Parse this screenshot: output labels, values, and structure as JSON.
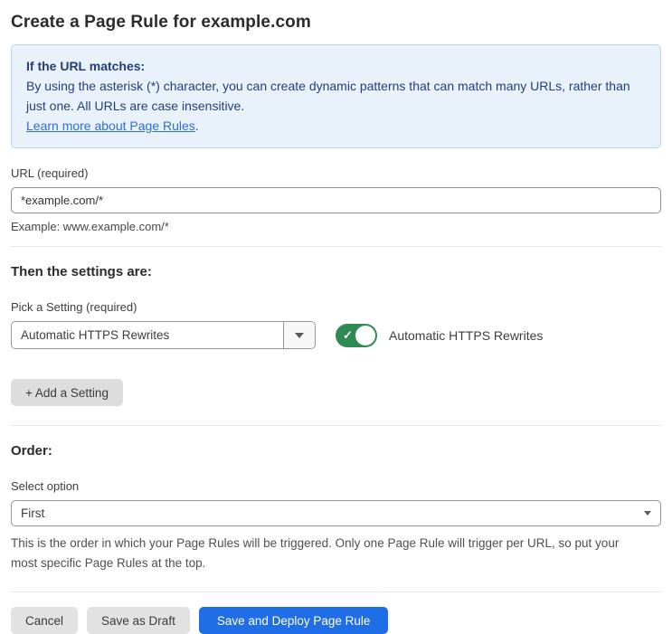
{
  "page": {
    "title": "Create a Page Rule for example.com"
  },
  "info_box": {
    "heading": "If the URL matches:",
    "body": "By using the asterisk (*) character, you can create dynamic patterns that can match many URLs, rather than just one. All URLs are case insensitive.",
    "link_text": "Learn more about Page Rules",
    "link_suffix": "."
  },
  "url_field": {
    "label": "URL (required)",
    "value": "*example.com/*",
    "hint": "Example: www.example.com/*"
  },
  "settings_section": {
    "heading": "Then the settings are:",
    "picker_label": "Pick a Setting (required)",
    "picker_value": "Automatic HTTPS Rewrites",
    "toggle_state": "on",
    "toggle_check": "✓",
    "toggle_label": "Automatic HTTPS Rewrites",
    "add_button_label": "+ Add a Setting"
  },
  "order_section": {
    "heading": "Order:",
    "select_label": "Select option",
    "select_value": "First",
    "description": "This is the order in which your Page Rules will be triggered. Only one Page Rule will trigger per URL, so put your most specific Page Rules at the top."
  },
  "footer": {
    "cancel_label": "Cancel",
    "save_draft_label": "Save as Draft",
    "save_deploy_label": "Save and Deploy Page Rule"
  },
  "colors": {
    "primary_button_blue": "#1f6ee8",
    "toggle_green": "#2f8a54",
    "info_box_bg": "#e9f2fb",
    "info_box_border": "#b9d6f0",
    "info_box_text": "#24407a",
    "link_blue": "#2d6ed9"
  }
}
